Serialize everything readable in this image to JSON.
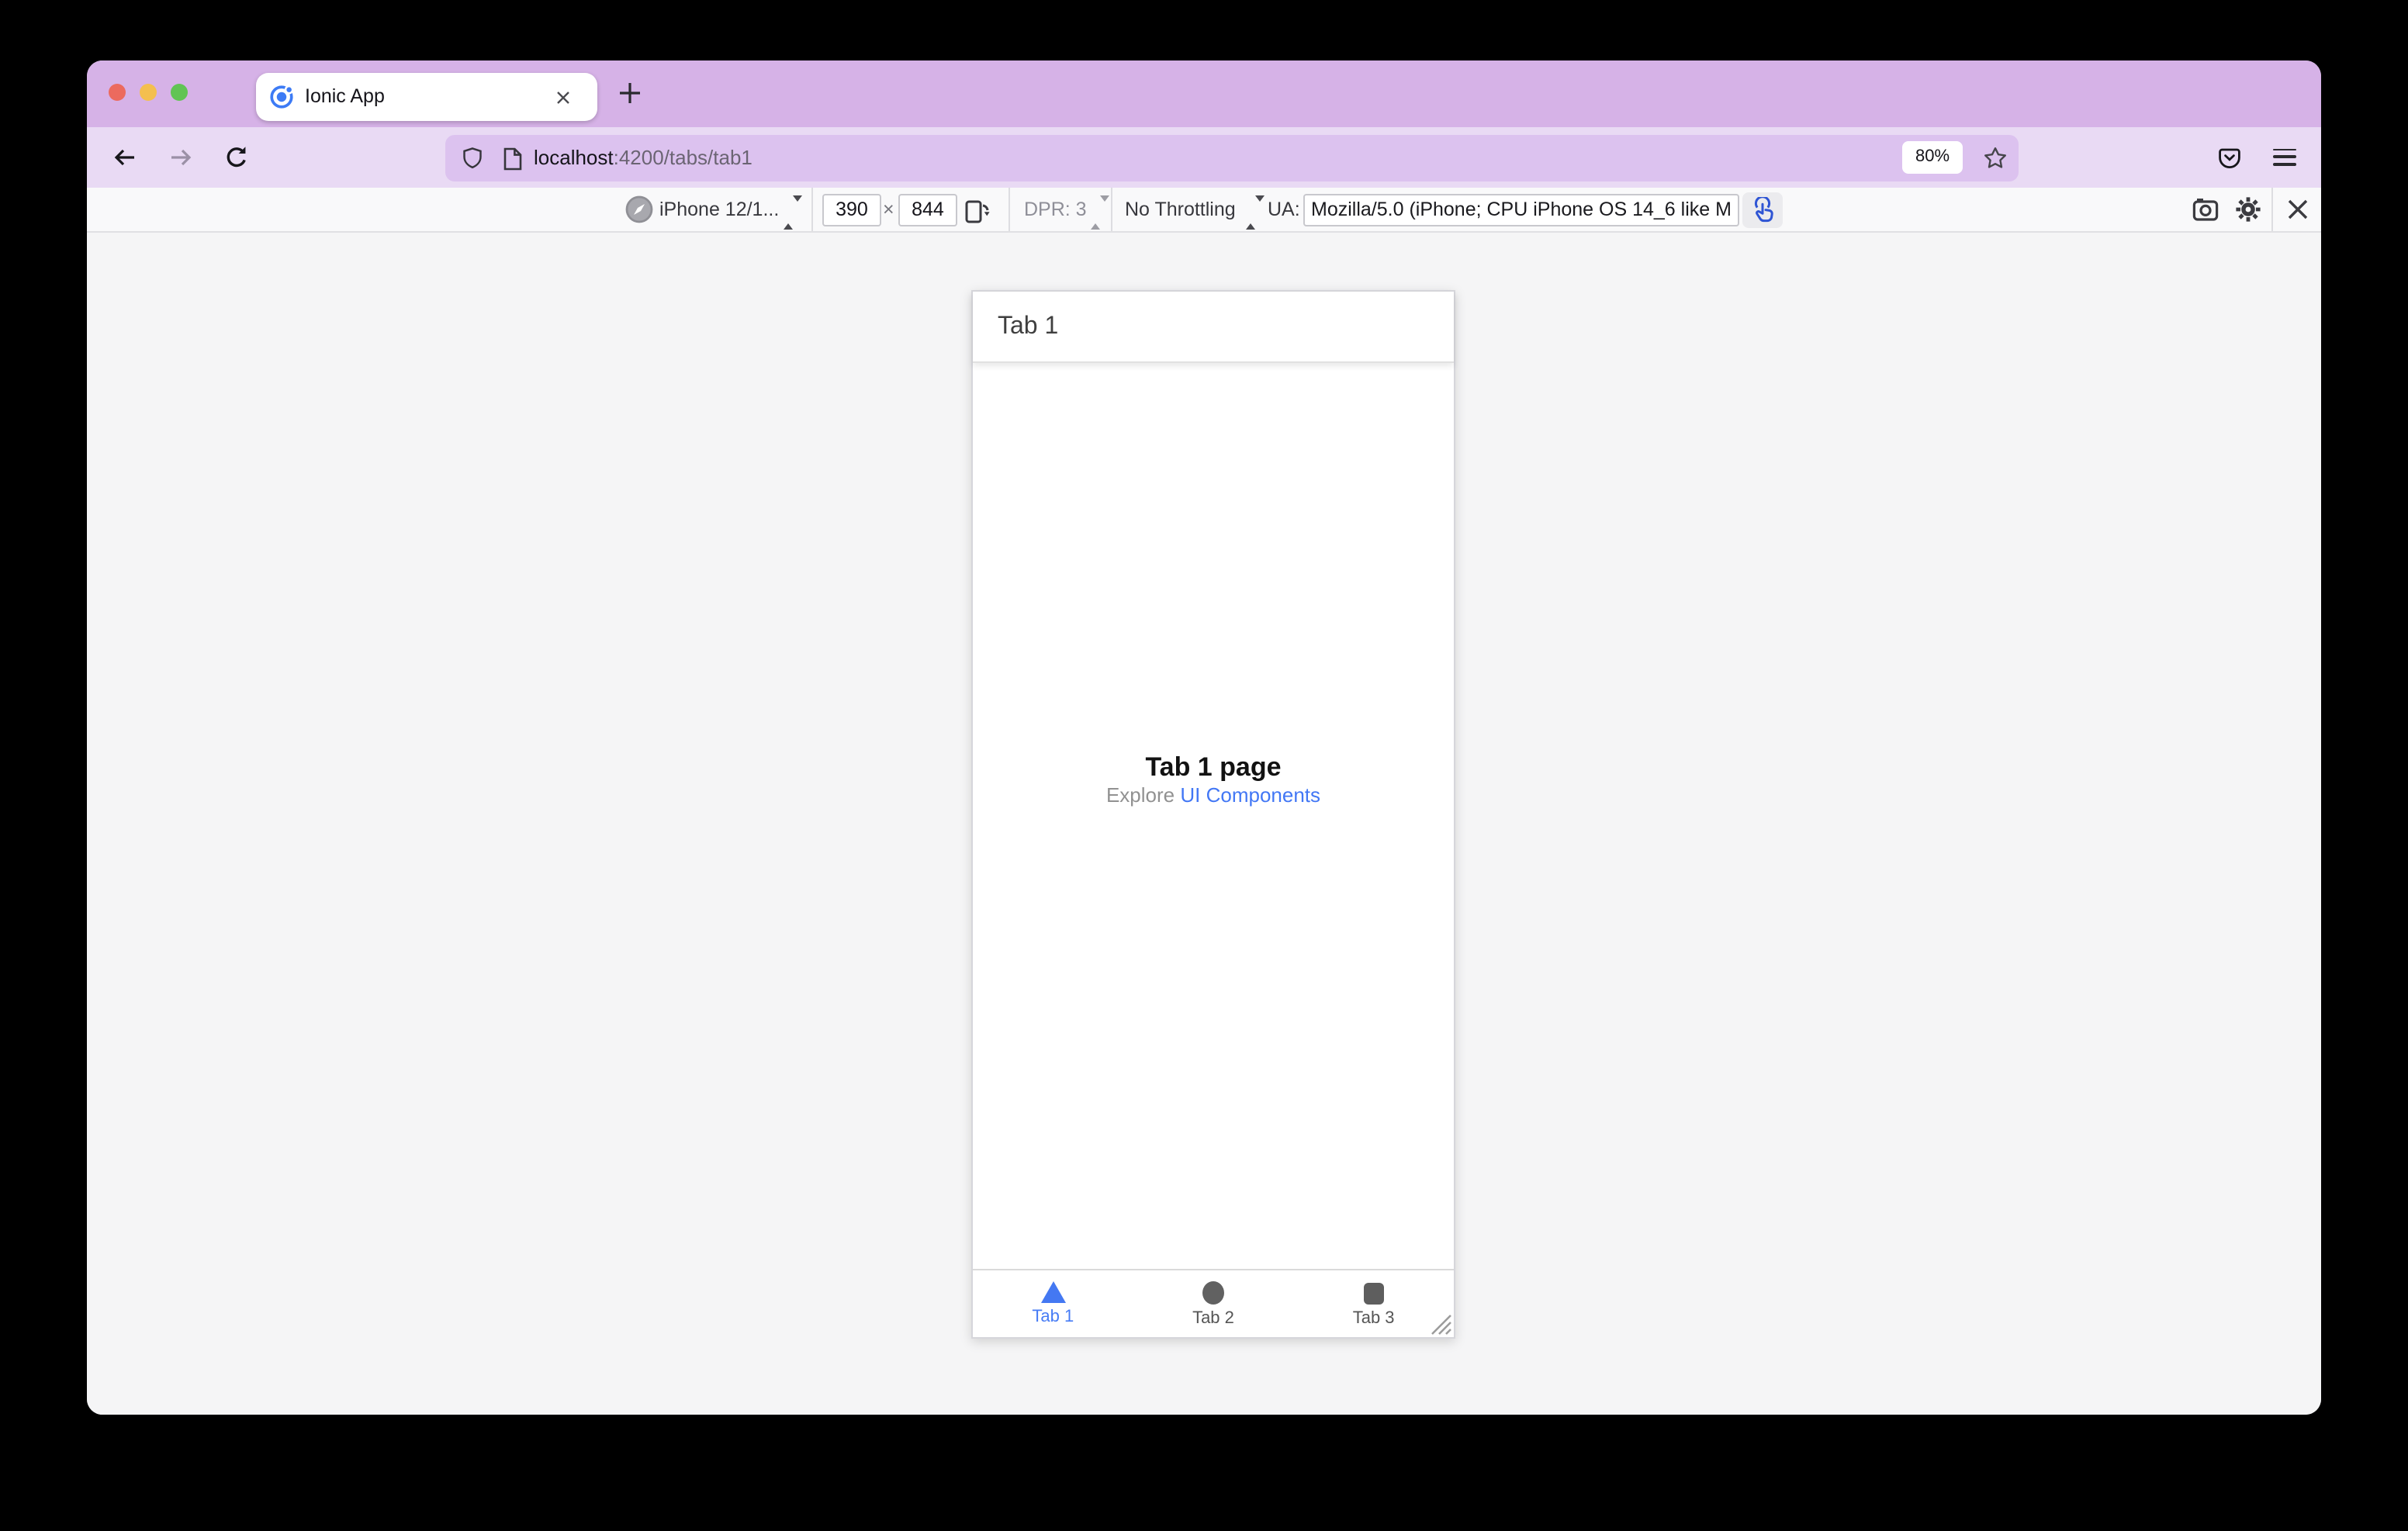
{
  "window": {
    "tab_title": "Ionic App",
    "urlbar": {
      "host": "localhost",
      "path": ":4200/tabs/tab1",
      "zoom_badge": "80%"
    }
  },
  "rdm_toolbar": {
    "device": "iPhone 12/1...",
    "viewport_width": "390",
    "times": "×",
    "viewport_height": "844",
    "dpr": "DPR: 3",
    "throttling": "No Throttling",
    "ua_label": "UA:",
    "ua_value": "Mozilla/5.0 (iPhone; CPU iPhone OS 14_6 like M"
  },
  "phone": {
    "header_title": "Tab 1",
    "page_title": "Tab 1 page",
    "explore_prefix": "Explore ",
    "explore_link": "UI Components",
    "tabs": [
      {
        "label": "Tab 1",
        "icon": "triangle",
        "active": true
      },
      {
        "label": "Tab 2",
        "icon": "circle",
        "active": false
      },
      {
        "label": "Tab 3",
        "icon": "square",
        "active": false
      }
    ]
  },
  "colors": {
    "tabstrip_purple": "#d6b2e7",
    "navbar_purple": "#e9daf4",
    "urlchip_purple": "#dcc2ef",
    "toolbar_bg": "#f9f9fa",
    "content_bg": "#f5f5f6",
    "accent_blue": "#4478f2",
    "link_blue": "#4277f5",
    "touch_icon_blue": "#2f55d4",
    "traffic_red": "#ec6a5e",
    "traffic_yellow": "#f4bf4f",
    "traffic_green": "#61c454"
  }
}
